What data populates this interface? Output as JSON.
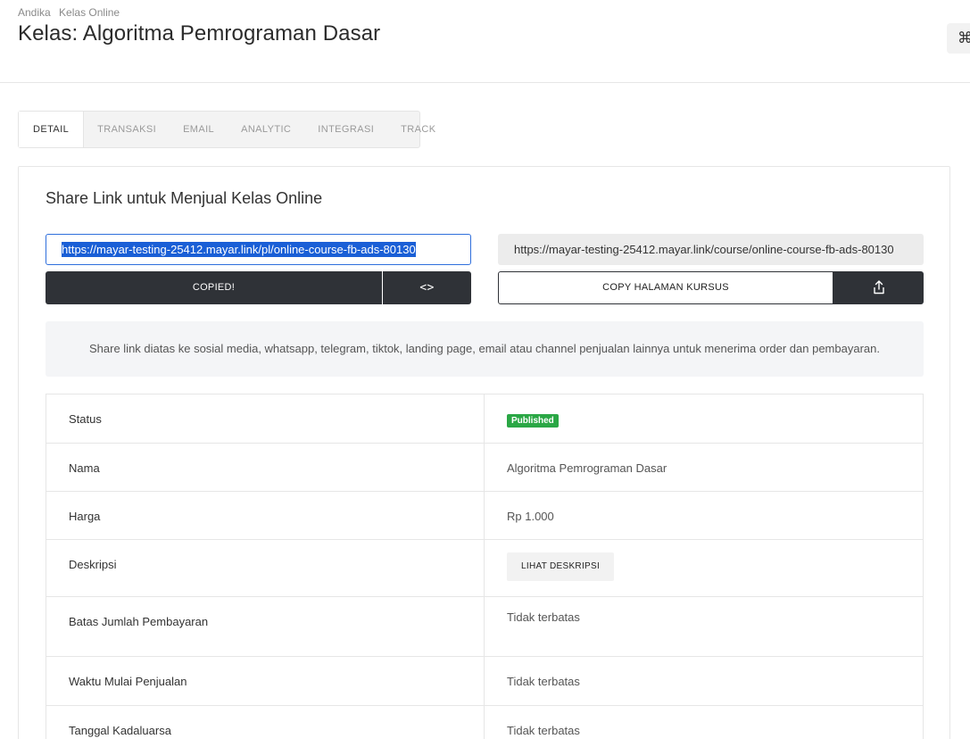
{
  "breadcrumb": [
    "Andika",
    "Kelas Online"
  ],
  "page_title": "Kelas: Algoritma Pemrograman Dasar",
  "command_icon": "⌘",
  "tabs": [
    {
      "label": "DETAIL",
      "active": true
    },
    {
      "label": "TRANSAKSI",
      "active": false
    },
    {
      "label": "EMAIL",
      "active": false
    },
    {
      "label": "ANALYTIC",
      "active": false
    },
    {
      "label": "INTEGRASI",
      "active": false
    },
    {
      "label": "TRACK",
      "active": false
    }
  ],
  "share": {
    "title": "Share Link untuk Menjual Kelas Online",
    "payment_link": "https://mayar-testing-25412.mayar.link/pl/online-course-fb-ads-80130",
    "course_link": "https://mayar-testing-25412.mayar.link/course/online-course-fb-ads-80130",
    "copied_label": "COPIED!",
    "embed_icon": "<>",
    "copy_course_label": "COPY HALAMAN KURSUS",
    "share_icon": "share-icon",
    "info_text": "Share link diatas ke sosial media, whatsapp, telegram, tiktok, landing page, email atau channel penjualan lainnya untuk menerima order dan pembayaran."
  },
  "details": {
    "status_label": "Status",
    "status_value": "Published",
    "status_color": "#2aa745",
    "nama_label": "Nama",
    "nama_value": "Algoritma Pemrograman Dasar",
    "harga_label": "Harga",
    "harga_value": "Rp 1.000",
    "deskripsi_label": "Deskripsi",
    "deskripsi_button": "LIHAT DESKRIPSI",
    "batas_label": "Batas Jumlah Pembayaran",
    "batas_value": "Tidak terbatas",
    "waktu_label": "Waktu Mulai Penjualan",
    "waktu_value": "Tidak terbatas",
    "tanggal_label": "Tanggal Kadaluarsa",
    "tanggal_value": "Tidak terbatas"
  }
}
